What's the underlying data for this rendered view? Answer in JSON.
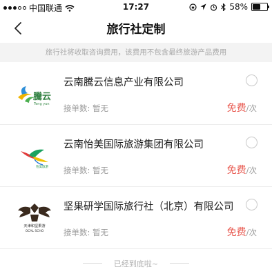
{
  "status_bar": {
    "carrier": "中国联通",
    "time": "17:27",
    "battery_percent": "58%",
    "battery_level": 0.58,
    "icons": [
      "signal-icon",
      "wifi-icon",
      "lock-rotation-icon",
      "location-icon",
      "alarm-icon",
      "bluetooth-icon",
      "battery-icon"
    ]
  },
  "nav": {
    "title": "旅行社定制",
    "back_icon": "chevron-left-icon"
  },
  "notice": "旅行社将收取咨询费用，该费用不包含最终旅游产品费用",
  "agencies": [
    {
      "name": "云南騰云信息产业有限公司",
      "orders_label": "接单数:",
      "orders_value": "暂无",
      "price": "免费",
      "unit": "/次",
      "logo": {
        "text": "騰云",
        "subtext": "Teng yun"
      }
    },
    {
      "name": "云南怡美国际旅游集团有限公司",
      "orders_label": "接单数:",
      "orders_value": "暂无",
      "price": "免费",
      "unit": "/次",
      "logo": {
        "text": "怡美旅游"
      }
    },
    {
      "name": "坚果研学国际旅行社（北京）有限公司",
      "orders_label": "接单数:",
      "orders_value": "暂无",
      "price": "免费",
      "unit": "/次",
      "logo": {
        "text": "天津和坚果游",
        "subtext": "OCAL SCHO"
      }
    }
  ],
  "footer": "已经到底啦~",
  "colors": {
    "accent_red": "#e8584f",
    "muted_text": "#9a9a9a",
    "notice_bg": "#f3f3f3"
  }
}
